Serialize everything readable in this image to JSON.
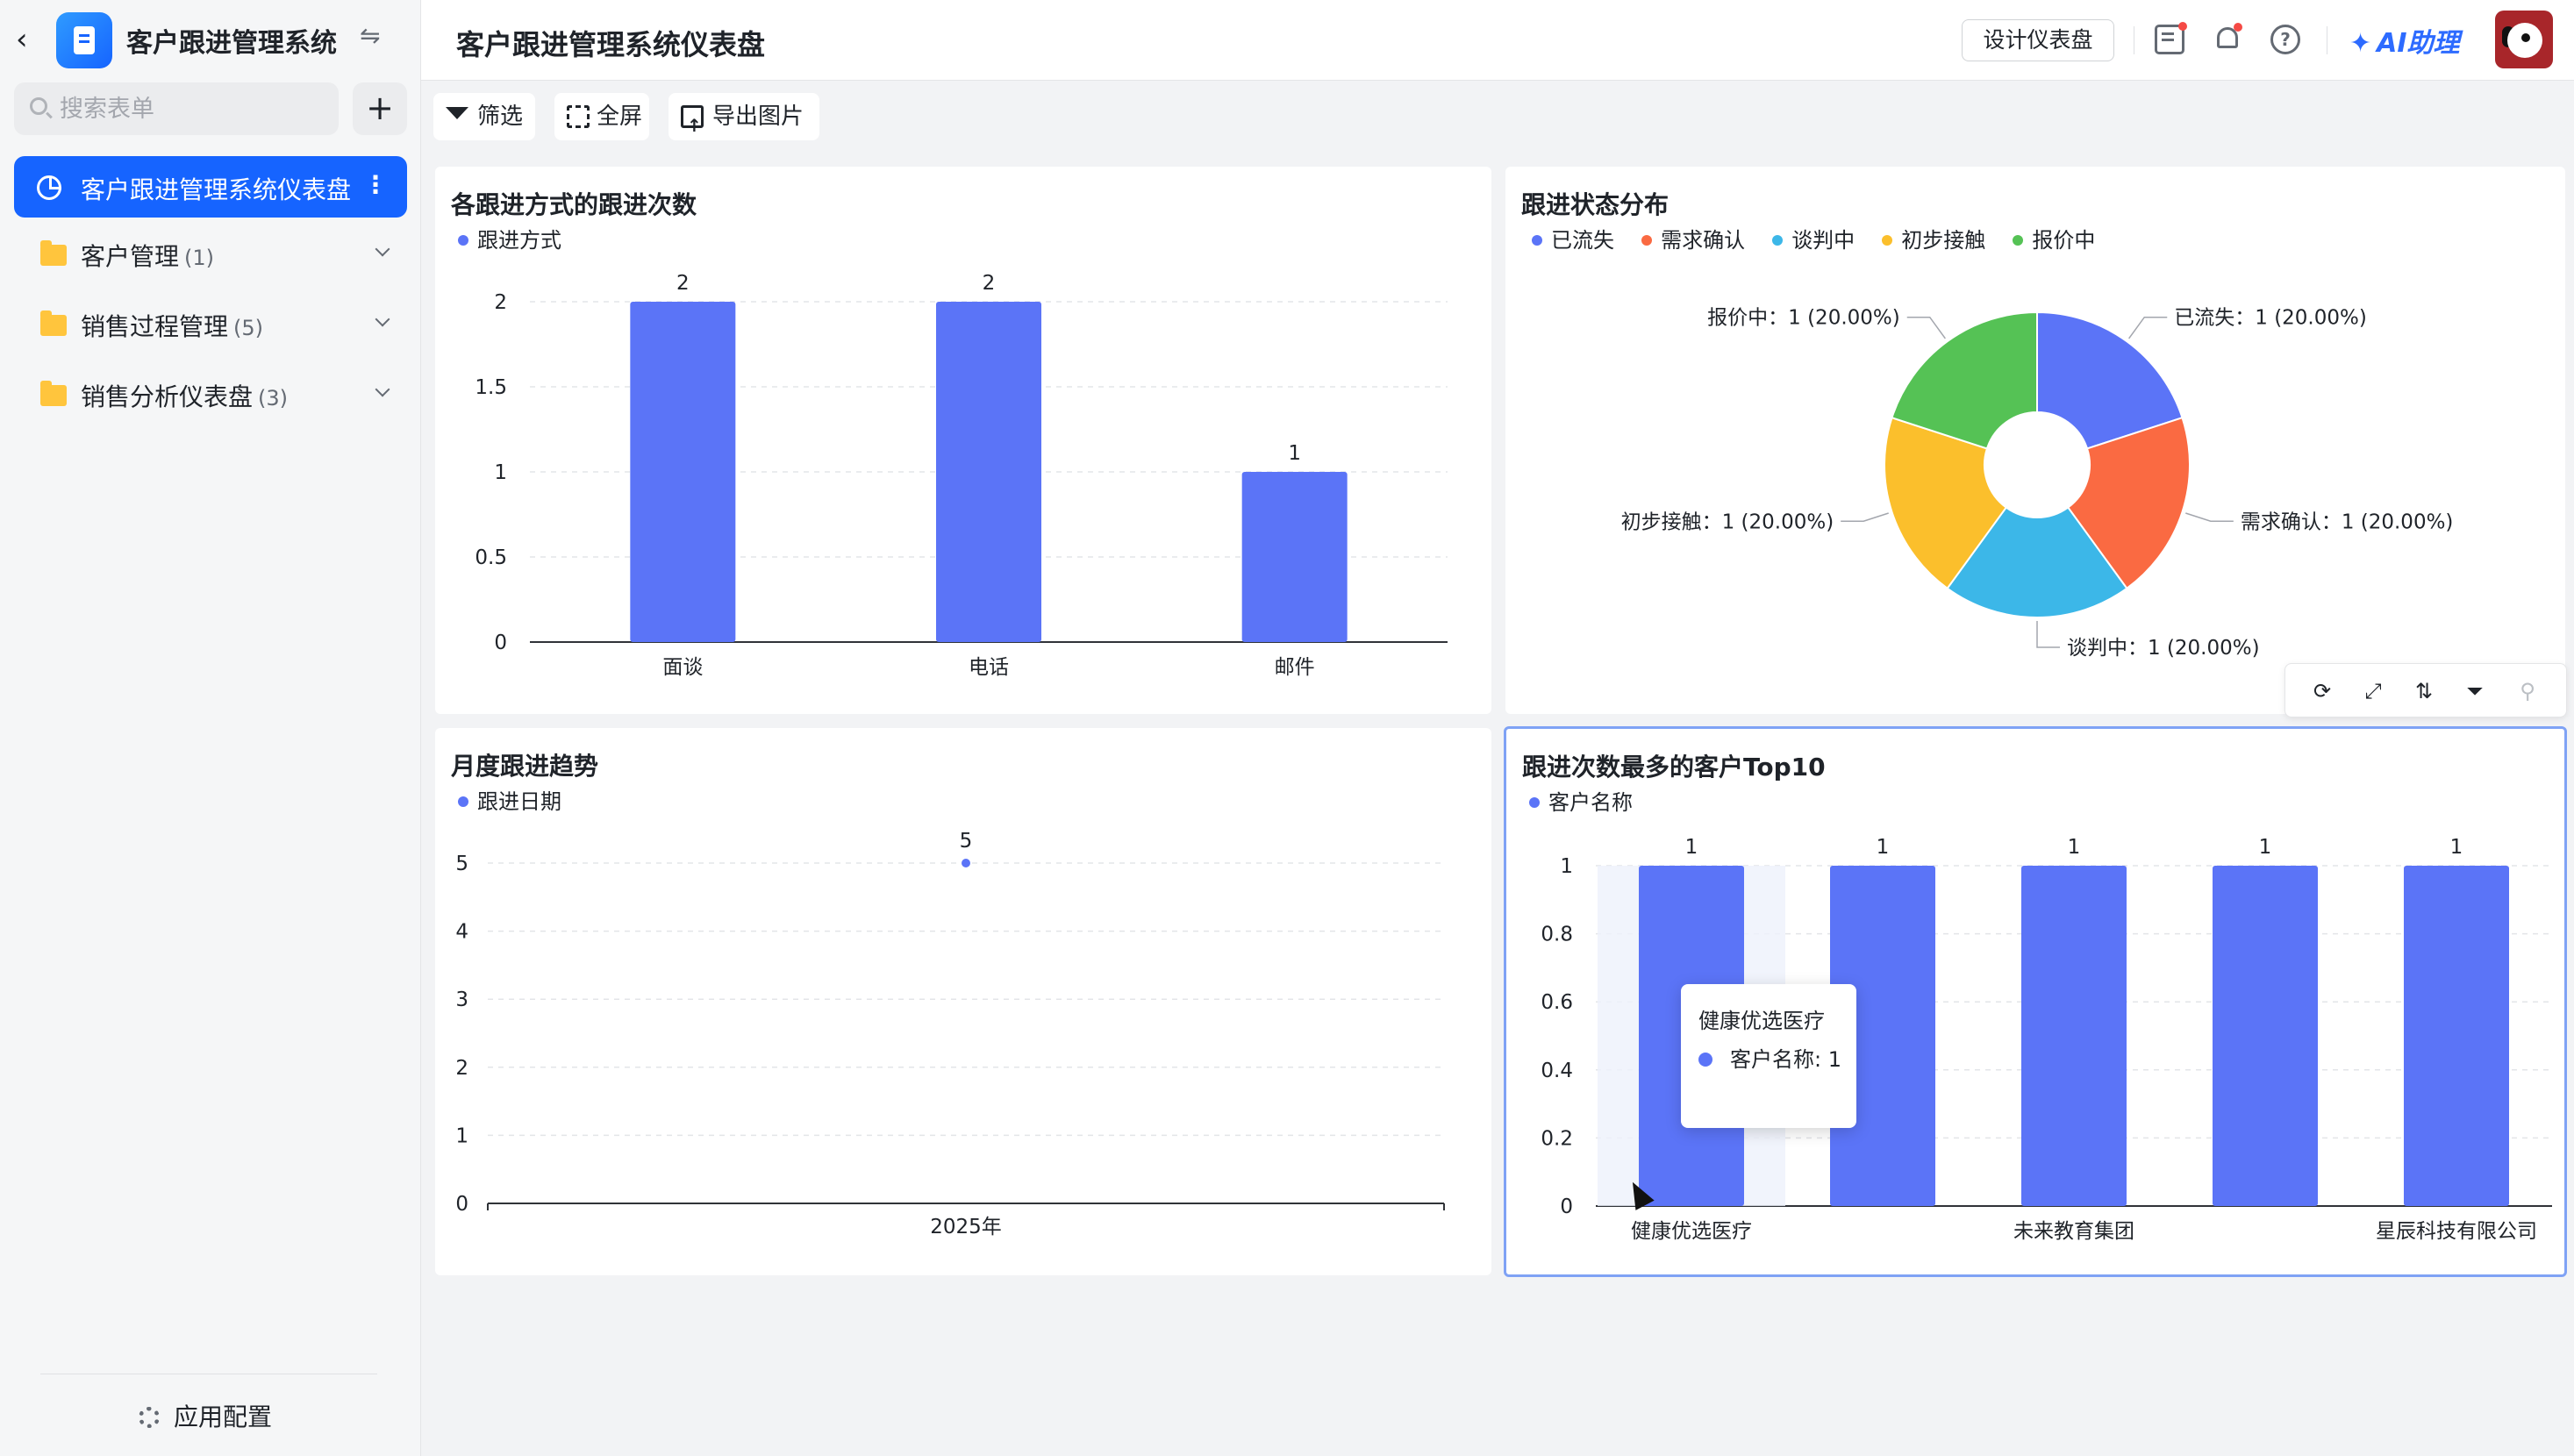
{
  "sidebar": {
    "app_title": "客户跟进管理系统",
    "search_placeholder": "搜索表单",
    "items": [
      {
        "label": "客户跟进管理系统仪表盘",
        "count": ""
      },
      {
        "label": "客户管理",
        "count": "(1)"
      },
      {
        "label": "销售过程管理",
        "count": "(5)"
      },
      {
        "label": "销售分析仪表盘",
        "count": "(3)"
      }
    ],
    "config_label": "应用配置"
  },
  "header": {
    "title": "客户跟进管理系统仪表盘",
    "design_button": "设计仪表盘",
    "ai_label": "AI助理"
  },
  "toolbar": {
    "filter": "筛选",
    "fullscreen": "全屏",
    "export": "导出图片"
  },
  "colors": {
    "accent": "#1664ff",
    "bar": "#5b74f7"
  },
  "chart_data": [
    {
      "type": "bar",
      "title": "各跟进方式的跟进次数",
      "categories": [
        "面谈",
        "电话",
        "邮件"
      ],
      "series": [
        {
          "name": "跟进方式",
          "values": [
            2,
            2,
            1
          ]
        }
      ],
      "yticks": [
        "0",
        "0.5",
        "1",
        "1.5",
        "2"
      ],
      "ylim": [
        0,
        2
      ],
      "grid": true,
      "legend": "top-left"
    },
    {
      "type": "pie",
      "title": "跟进状态分布",
      "slices": [
        {
          "label": "已流失",
          "value": 1,
          "text": "已流失：1 (20.00%)",
          "color": "#5b74f7"
        },
        {
          "label": "需求确认",
          "value": 1,
          "text": "需求确认：1 (20.00%)",
          "color": "#fa6a42"
        },
        {
          "label": "谈判中",
          "value": 1,
          "text": "谈判中：1 (20.00%)",
          "color": "#3cb7e8"
        },
        {
          "label": "初步接触",
          "value": 1,
          "text": "初步接触：1 (20.00%)",
          "color": "#fbbf2c"
        },
        {
          "label": "报价中",
          "value": 1,
          "text": "报价中：1 (20.00%)",
          "color": "#55c255"
        }
      ],
      "donut": true,
      "legend": "top-left"
    },
    {
      "type": "line",
      "title": "月度跟进趋势",
      "categories": [
        "2025年"
      ],
      "series": [
        {
          "name": "跟进日期",
          "values": [
            5
          ]
        }
      ],
      "yticks": [
        "0",
        "1",
        "2",
        "3",
        "4",
        "5"
      ],
      "ylim": [
        0,
        5
      ],
      "grid": true,
      "legend": "top-left"
    },
    {
      "type": "bar",
      "title": "跟进次数最多的客户Top10",
      "categories": [
        "健康优选医疗",
        "",
        "未来教育集团",
        "",
        "星辰科技有限公司"
      ],
      "series": [
        {
          "name": "客户名称",
          "values": [
            1,
            1,
            1,
            1,
            1
          ]
        }
      ],
      "yticks": [
        "0",
        "0.2",
        "0.4",
        "0.6",
        "0.8",
        "1"
      ],
      "ylim": [
        0,
        1
      ],
      "grid": true,
      "legend": "top-left",
      "tooltip": {
        "title": "健康优选医疗",
        "row": "客户名称: 1"
      }
    }
  ]
}
